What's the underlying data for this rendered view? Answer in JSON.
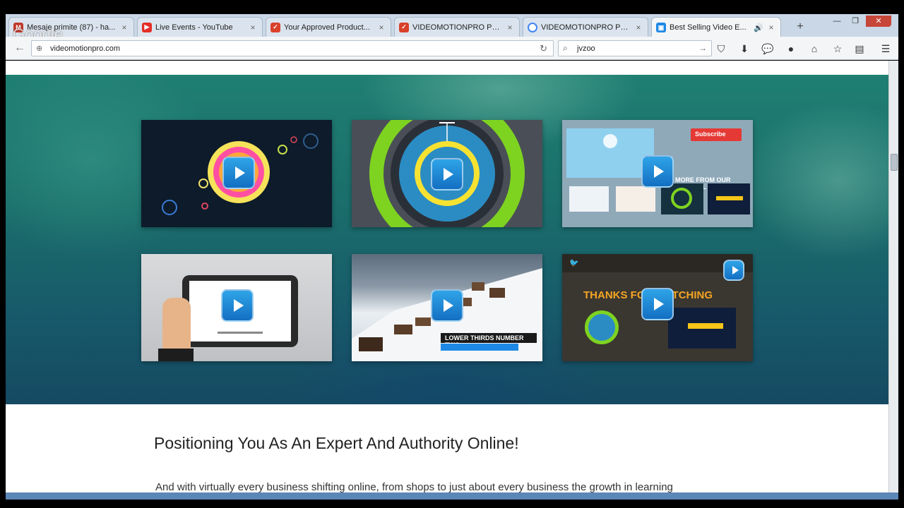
{
  "browser": {
    "overlay_logo": "Google",
    "tabs": [
      {
        "label": "Mesaje primite (87) - ha...",
        "favicon": "mail-icon",
        "color": "#c0392b"
      },
      {
        "label": "Live Events - YouTube",
        "favicon": "youtube-icon",
        "color": "#e52d27"
      },
      {
        "label": "Your Approved Product...",
        "favicon": "jvzoo-icon",
        "color": "#d9412b"
      },
      {
        "label": "VIDEOMOTIONPRO PRE...",
        "favicon": "jvzoo-icon",
        "color": "#d9412b"
      },
      {
        "label": "VIDEOMOTIONPRO PRE...",
        "favicon": "google-icon",
        "color": "#4285f4"
      },
      {
        "label": "Best Selling Video E...",
        "favicon": "video-icon",
        "color": "#1e88e5",
        "active": true
      }
    ],
    "new_tab": "+",
    "url": "videomotionpro.com",
    "search_value": "jvzoo"
  },
  "hero": {
    "thumbnails": [
      {
        "name": "thumb-circles",
        "captions": []
      },
      {
        "name": "thumb-rings",
        "captions": []
      },
      {
        "name": "thumb-channel",
        "captions": [
          "Subscribe",
          "MORE FROM OUR CHANNEL"
        ]
      },
      {
        "name": "thumb-tablet",
        "captions": []
      },
      {
        "name": "thumb-snow-village",
        "captions": [
          "LOWER THIRDS NUMBER TWO"
        ]
      },
      {
        "name": "thumb-thanks",
        "captions": [
          "THANKS FOR WATCHING"
        ]
      }
    ]
  },
  "content": {
    "heading": "Positioning You As An Expert And Authority Online!",
    "paragraph": "And with virtually every business shifting online, from shops to just about every business the growth in learning"
  }
}
